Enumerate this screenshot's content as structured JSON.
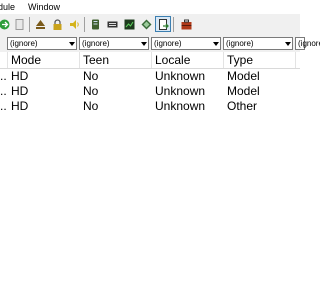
{
  "menubar": {
    "items": [
      "dule",
      "Window"
    ]
  },
  "toolbar": {
    "buttons": [
      {
        "icon": "green-arrow-icon",
        "color": "#2e9e3a"
      },
      {
        "icon": "page-icon",
        "color": "#9a9a9a"
      },
      {
        "icon": "eject-icon",
        "color": "#7a5a1a"
      },
      {
        "icon": "lock-icon",
        "color": "#c9a21b"
      },
      {
        "icon": "speaker-icon",
        "color": "#d4b31a"
      },
      {
        "icon": "server-icon",
        "color": "#3f5f2f"
      },
      {
        "icon": "keyboard-icon",
        "color": "#333333"
      },
      {
        "icon": "chart-icon",
        "color": "#2a7d2a"
      },
      {
        "icon": "diamond-icon",
        "color": "#3a6b3a"
      },
      {
        "icon": "document-export-icon",
        "color": "#2e7d32",
        "selected": true
      },
      {
        "icon": "briefcase-icon",
        "color": "#b03a1a"
      }
    ]
  },
  "filters": [
    "(ignore)",
    "(ignore)",
    "(ignore)",
    "(ignore)",
    "(ignore)"
  ],
  "table": {
    "columns": [
      "Mode",
      "Teen",
      "Locale",
      "Type"
    ],
    "rows": [
      {
        "prefix": "..",
        "mode": "HD",
        "teen": "No",
        "locale": "Unknown",
        "type": "Model"
      },
      {
        "prefix": "..",
        "mode": "HD",
        "teen": "No",
        "locale": "Unknown",
        "type": "Model"
      },
      {
        "prefix": "..",
        "mode": "HD",
        "teen": "No",
        "locale": "Unknown",
        "type": "Other"
      }
    ]
  }
}
